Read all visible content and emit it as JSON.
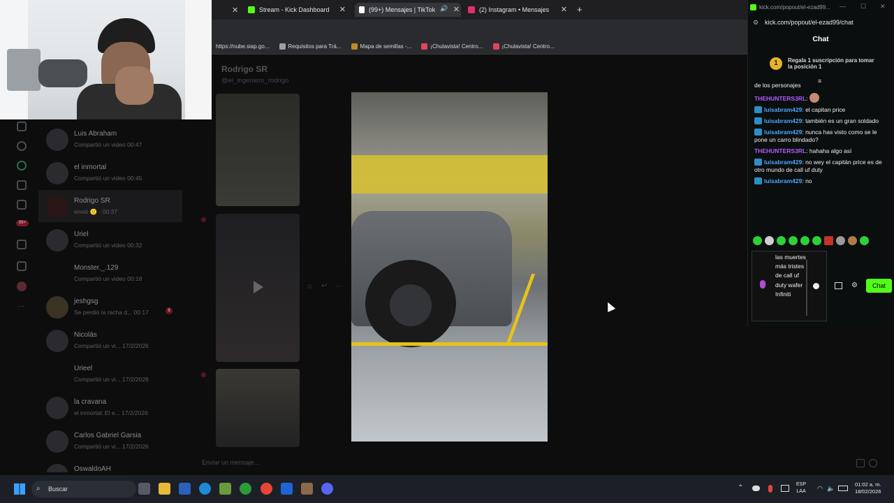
{
  "browser": {
    "tabs": [
      {
        "label": "Stream - Kick Dashboard",
        "color": "#53fc18"
      },
      {
        "label": "(99+) Mensajes | TikTok",
        "color": "#ffffff"
      },
      {
        "label": "(2) Instagram • Mensajes",
        "color": "#e1306c"
      }
    ],
    "new_tab": "+",
    "bookmarks": [
      {
        "label": "https://nube.siap.go...",
        "color": "#888888"
      },
      {
        "label": "Requisitos para Trá...",
        "color": "#9aa0a6"
      },
      {
        "label": "Mapa de semillas -...",
        "color": "#c08a2a"
      },
      {
        "label": "¡Chulavista! Centro...",
        "color": "#e0455a"
      },
      {
        "label": "¡Chulavista! Centro...",
        "color": "#e0455a"
      }
    ]
  },
  "dm_list": [
    {
      "name": "Luis Abraham",
      "sub": "Compartió un video 00:47"
    },
    {
      "name": "el inmortal",
      "sub": "Compartió un video 00:45"
    },
    {
      "name": "Rodrigo SR",
      "sub": "envió 🙂 · 00:37",
      "selected": true
    },
    {
      "name": "Uriel",
      "sub": "Compartió un video 00:32"
    },
    {
      "name": "Monster._.129",
      "sub": "Compartió un video 00:18"
    },
    {
      "name": "jeshgsg",
      "sub": "Se perdió la racha d... 00:17",
      "badge": "9"
    },
    {
      "name": "Nicolás",
      "sub": "Compartió un vi... 17/2/2026"
    },
    {
      "name": "Urieel",
      "sub": "Compartió un vi... 17/2/2026"
    },
    {
      "name": "la cravana",
      "sub": "el inmortal: El e... 17/2/2026"
    },
    {
      "name": "Carlos Gabriel Garsia",
      "sub": "Compartió un vi... 17/2/2026"
    },
    {
      "name": "OswaldoAH",
      "sub": ""
    }
  ],
  "conversation": {
    "name": "Rodrigo SR",
    "username": "@el_ingeniero_rodrigo",
    "input_placeholder": "Enviar un mensaje..."
  },
  "kick": {
    "window_title": "kick.com/popout/el-ezad99...",
    "url": "kick.com/popout/el-ezad99/chat",
    "header": "Chat",
    "sub_promo": {
      "rank": "1",
      "text": "Regala 1 suscripción para tomar la posición 1"
    },
    "messages": [
      {
        "user": "",
        "text": "de los personajes",
        "color": "#ffffff"
      },
      {
        "user": "THEHUNTERS3RL",
        "text": "",
        "color": "#b15bff"
      },
      {
        "user": "luisabram429",
        "text": "el capitan price",
        "color": "#4aa8ff"
      },
      {
        "user": "luisabram429",
        "text": "también es un gran soldado",
        "color": "#4aa8ff"
      },
      {
        "user": "luisabram429",
        "text": "nunca has visto como se le pone un carro blindado?",
        "color": "#4aa8ff"
      },
      {
        "user": "THEHUNTERS3RL",
        "text": "hahaha algo así",
        "color": "#b15bff"
      },
      {
        "user": "luisabram429",
        "text": "no wey el capitán price es de otro mundo de call uf duty",
        "color": "#4aa8ff"
      },
      {
        "user": "luisabram429",
        "text": "no",
        "color": "#4aa8ff"
      }
    ],
    "input_text": "las muertes más tristes de call uf duty wafer Infiniti",
    "chat_button": "Chat"
  },
  "taskbar": {
    "search": "Buscar",
    "lang": "ESP\nLAA",
    "time": "01:02 a. m.",
    "date": "18/02/2026"
  }
}
